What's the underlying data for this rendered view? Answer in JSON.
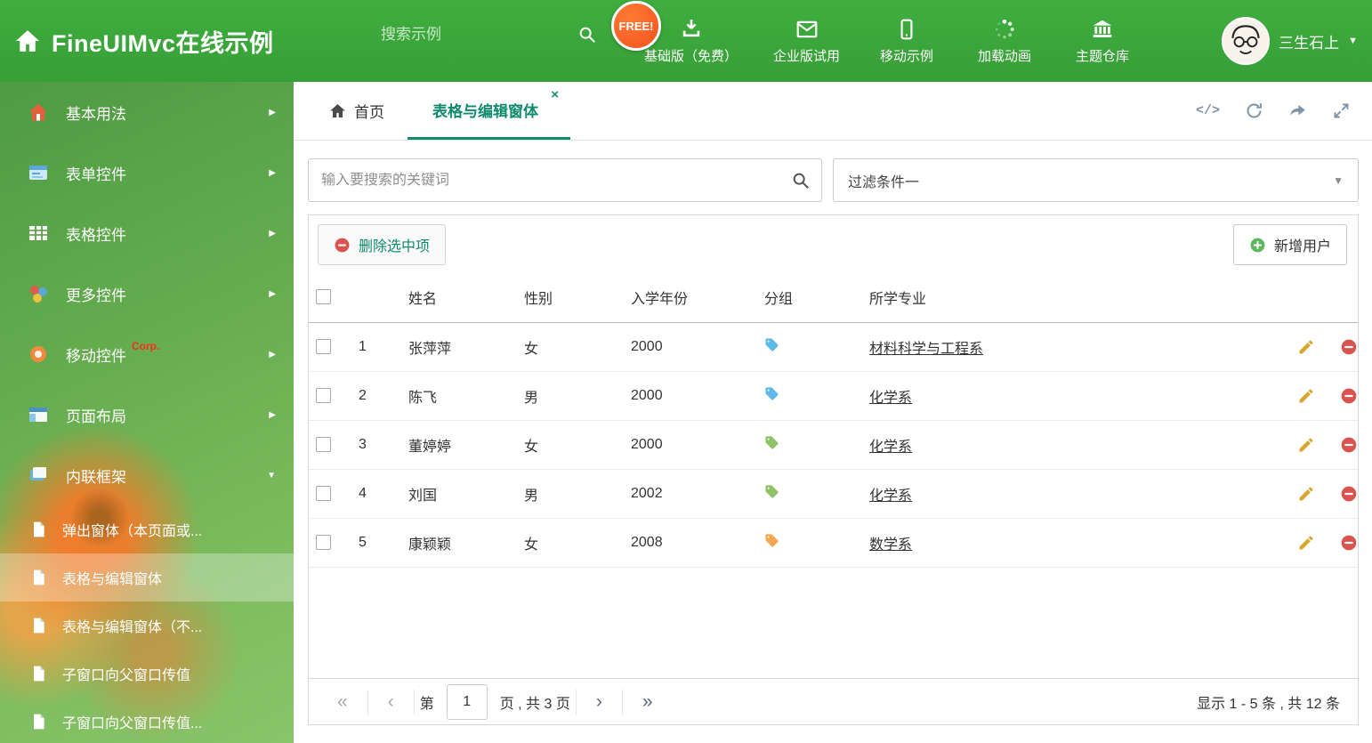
{
  "colors": {
    "header_green": "#3ba53b",
    "accent_teal": "#0f8a6d",
    "free_badge_orange": "#f4511e",
    "corp_red": "#ff2d1a",
    "delete_red": "#d9534f",
    "add_green": "#5cb85c",
    "pencil_gold": "#d9a62e"
  },
  "icons": {
    "close": "×",
    "caret_down": "▼",
    "chevron_right": "▶",
    "chevron_down": "▼",
    "code": "</>",
    "first_page": "«",
    "prev_page": "‹",
    "next_page": "›",
    "last_page": "»"
  },
  "header": {
    "title": "FineUIMvc在线示例",
    "search_placeholder": "搜索示例",
    "free_badge": "FREE!",
    "nav_items": [
      {
        "label": "基础版（免费）",
        "icon": "download-icon"
      },
      {
        "label": "企业版试用",
        "icon": "envelope-icon"
      },
      {
        "label": "移动示例",
        "icon": "mobile-icon"
      },
      {
        "label": "加载动画",
        "icon": "spinner-icon"
      },
      {
        "label": "主题仓库",
        "icon": "bank-icon"
      }
    ],
    "user_name": "三生石上"
  },
  "sidebar": {
    "items": [
      {
        "label": "基本用法",
        "icon": "home-icon"
      },
      {
        "label": "表单控件",
        "icon": "form-icon"
      },
      {
        "label": "表格控件",
        "icon": "table-icon"
      },
      {
        "label": "更多控件",
        "icon": "more-controls-icon"
      },
      {
        "label": "移动控件",
        "icon": "mobile-controls-icon",
        "badge": "Corp."
      },
      {
        "label": "页面布局",
        "icon": "layout-icon"
      },
      {
        "label": "内联框架",
        "icon": "iframe-icon"
      }
    ],
    "subitems": [
      {
        "label": "弹出窗体（本页面或..."
      },
      {
        "label": "表格与编辑窗体"
      },
      {
        "label": "表格与编辑窗体（不..."
      },
      {
        "label": "子窗口向父窗口传值"
      },
      {
        "label": "子窗口向父窗口传值..."
      }
    ]
  },
  "tabs": {
    "home": "首页",
    "active": "表格与编辑窗体"
  },
  "filters": {
    "search_placeholder": "输入要搜索的关键词",
    "filter_value": "过滤条件一"
  },
  "grid": {
    "delete_button": "删除选中项",
    "add_button": "新增用户",
    "columns": {
      "name": "姓名",
      "gender": "性别",
      "year": "入学年份",
      "group": "分组",
      "major": "所学专业"
    },
    "rows": [
      {
        "num": "1",
        "name": "张萍萍",
        "gender": "女",
        "year": "2000",
        "tag_color": "#5fb9e6",
        "major": "材料科学与工程系"
      },
      {
        "num": "2",
        "name": "陈飞",
        "gender": "男",
        "year": "2000",
        "tag_color": "#5fb9e6",
        "major": "化学系"
      },
      {
        "num": "3",
        "name": "董婷婷",
        "gender": "女",
        "year": "2000",
        "tag_color": "#8fc267",
        "major": "化学系"
      },
      {
        "num": "4",
        "name": "刘国",
        "gender": "男",
        "year": "2002",
        "tag_color": "#8fc267",
        "major": "化学系"
      },
      {
        "num": "5",
        "name": "康颖颖",
        "gender": "女",
        "year": "2008",
        "tag_color": "#f5a851",
        "major": "数学系"
      }
    ],
    "pagination": {
      "page_prefix": "第",
      "current_page": "1",
      "page_suffix": "页 , 共 3 页",
      "summary": "显示 1 - 5 条 , 共 12 条"
    }
  }
}
